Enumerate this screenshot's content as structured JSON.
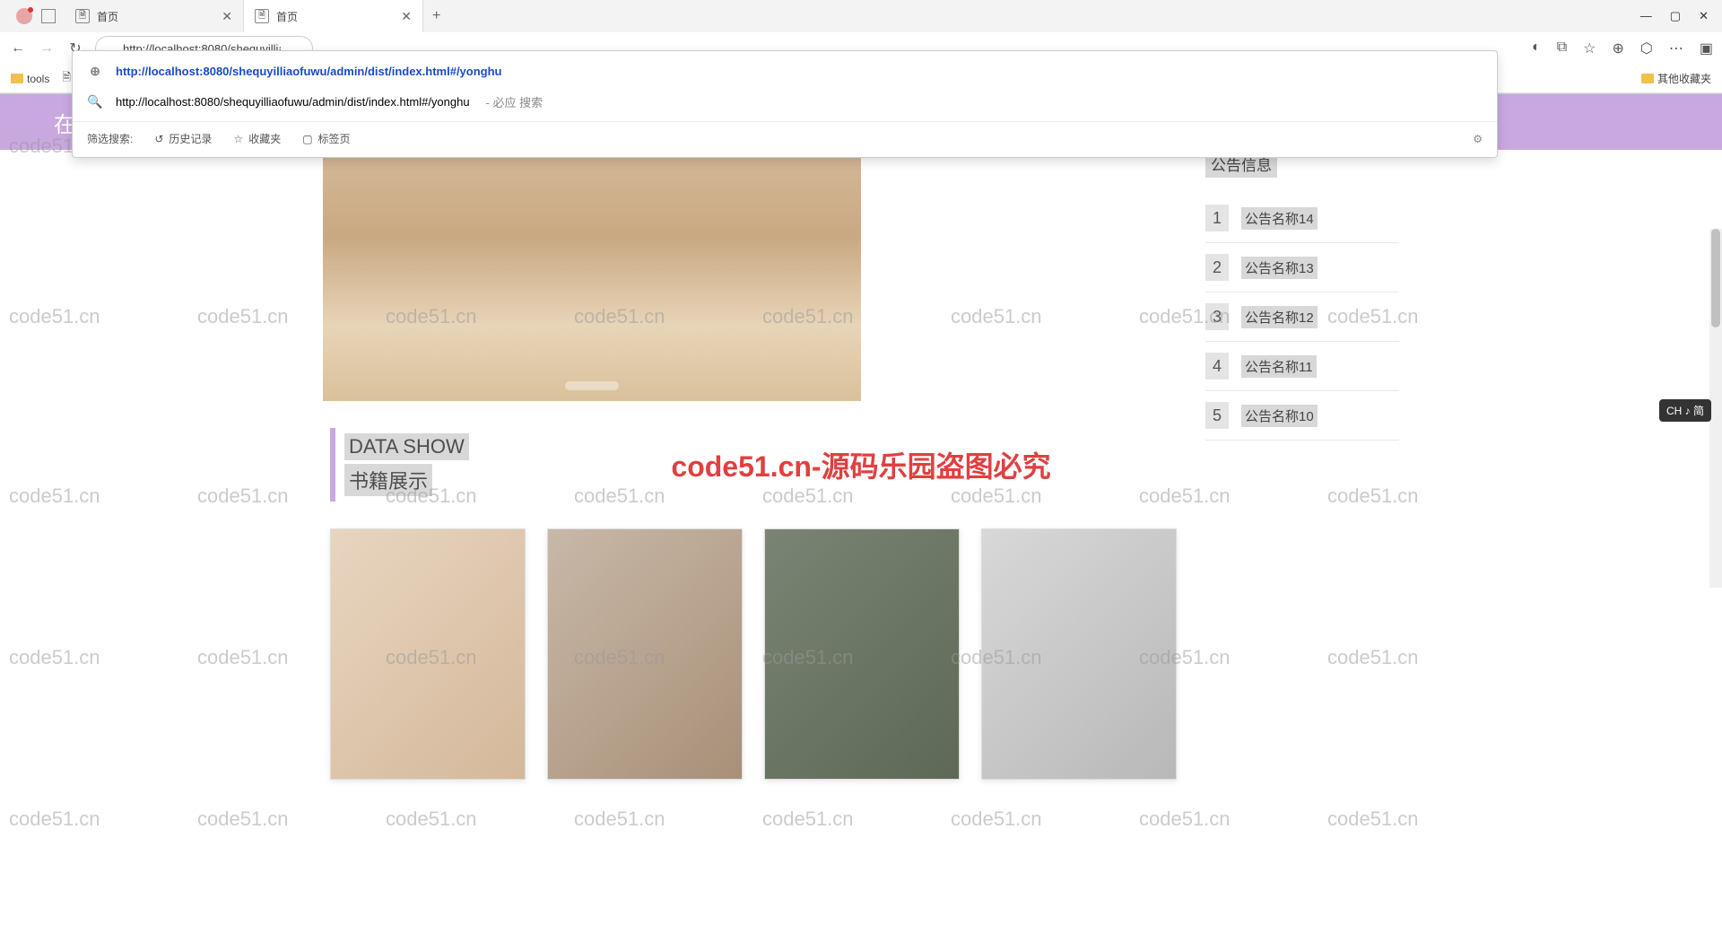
{
  "tabs": [
    {
      "title": "首页"
    },
    {
      "title": "首页"
    }
  ],
  "new_tab": "+",
  "window_controls": {
    "min": "—",
    "max": "▢",
    "close": "✕"
  },
  "nav": {
    "back": "←",
    "forward": "→",
    "reload": "↻"
  },
  "address_url": "http://localhost:8080/shequyilliaofuwu/admin/dist/index.html#/yonghu",
  "right_icons": [
    "◐",
    "⧉",
    "☆",
    "⊕",
    "⬡",
    "⋯",
    "▣"
  ],
  "bookmarks": {
    "tools": "tools",
    "other": "其他收藏夹"
  },
  "suggestions": {
    "primary": "http://localhost:8080/shequyilliaofuwu/admin/dist/index.html#/yonghu",
    "secondary_url": "http://localhost:8080/shequyilliaofuwu/admin/dist/index.html#/yonghu",
    "secondary_hint": "- 必应 搜索",
    "filter_label": "筛选搜索:",
    "history": "历史记录",
    "favorites": "收藏夹",
    "tabs": "标签页"
  },
  "banner_text": "在",
  "notice": {
    "title": "公告信息",
    "items": [
      {
        "n": "1",
        "t": "公告名称14"
      },
      {
        "n": "2",
        "t": "公告名称13"
      },
      {
        "n": "3",
        "t": "公告名称12"
      },
      {
        "n": "4",
        "t": "公告名称11"
      },
      {
        "n": "5",
        "t": "公告名称10"
      }
    ]
  },
  "section": {
    "en": "DATA SHOW",
    "cn": "书籍展示"
  },
  "watermark_text": "code51.cn",
  "center_watermark": "code51.cn-源码乐园盗图必究",
  "ime": "CH ♪ 简"
}
